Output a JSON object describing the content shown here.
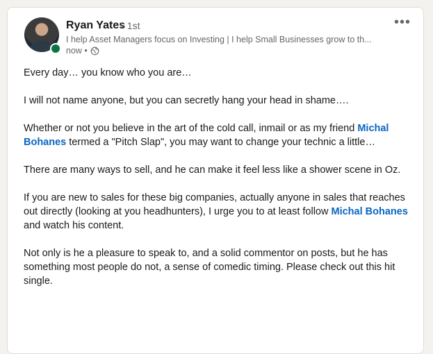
{
  "author": {
    "name": "Ryan Yates",
    "degree": "• 1st",
    "headline": "I help Asset Managers focus on Investing | I help Small Businesses grow to th...",
    "time": "now •"
  },
  "icons": {
    "more": "more-options-icon",
    "visibility": "globe-icon",
    "presence": "online-status-icon"
  },
  "post": {
    "p1": "Every day… you know who you are…",
    "p2": "I will not name anyone, but you can secretly hang your head in shame….",
    "p3_before": "Whether or not you believe in the art of the cold call, inmail or as my friend ",
    "mention1": "Michal Bohanes",
    "p3_after": " termed a \"Pitch Slap\", you may want to change your technic a little…",
    "p4": "There are many ways to sell, and he can make it feel less like a shower scene in Oz.",
    "p5_before": "If you are new to sales for these big companies, actually anyone in sales that reaches out directly (looking at you headhunters), I urge you to at least follow ",
    "mention2": "Michal Bohanes",
    "p5_after": " and watch his content.",
    "p6": "Not only is he a pleasure to speak to, and a solid commentor on posts, but he has something most people do not, a sense of comedic timing. Please check out this hit single."
  },
  "colors": {
    "mention": "#0a66c2",
    "presence": "#057642"
  }
}
